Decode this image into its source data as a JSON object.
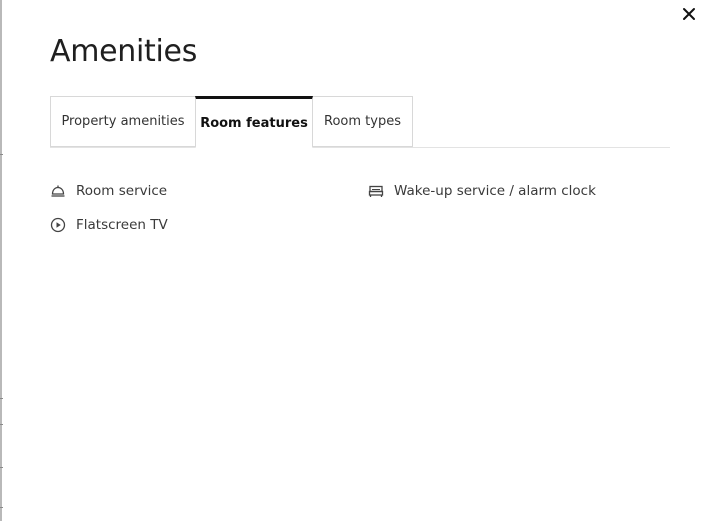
{
  "dialog": {
    "title": "Amenities",
    "close_label": "×"
  },
  "tabs": [
    {
      "label": "Property amenities",
      "selected": false
    },
    {
      "label": "Room features",
      "selected": true
    },
    {
      "label": "Room types",
      "selected": false
    }
  ],
  "room_features": [
    {
      "label": "Room service",
      "icon": "room-service-bell-icon"
    },
    {
      "label": "Flatscreen TV",
      "icon": "play-circle-icon"
    },
    {
      "label": "Wake-up service / alarm clock",
      "icon": "bed-icon"
    }
  ],
  "colors": {
    "active_tab_border": "#111111",
    "tab_border": "#d8d8d8",
    "text": "#3a3a3a"
  }
}
